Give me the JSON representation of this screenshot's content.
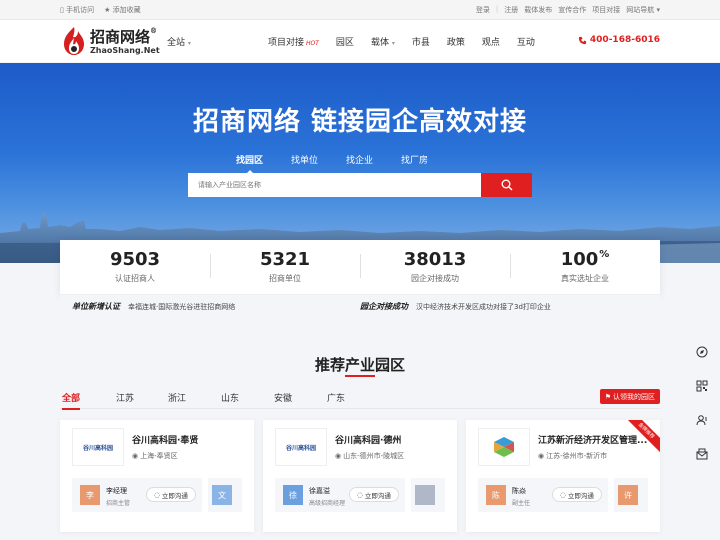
{
  "topbar": {
    "mobile": "手机访问",
    "favorite": "添加收藏",
    "links": [
      "登录",
      "注册",
      "载体发布",
      "宣传合作",
      "项目对接",
      "网站导航"
    ]
  },
  "header": {
    "logo_text": "招商网络",
    "logo_sub": "ZhaoShang.Net",
    "site_select": "全站",
    "nav": [
      {
        "label": "项目对接",
        "badge": "HOT"
      },
      {
        "label": "园区"
      },
      {
        "label": "载体"
      },
      {
        "label": "市县"
      },
      {
        "label": "政策"
      },
      {
        "label": "观点"
      },
      {
        "label": "互动"
      }
    ],
    "phone": "400-168-6016"
  },
  "hero": {
    "slogan": "招商网络 链接园企高效对接",
    "tabs": [
      "找园区",
      "找单位",
      "找企业",
      "找厂房"
    ],
    "search_placeholder": "请输入产业园区名称"
  },
  "stats": [
    {
      "value": "9503",
      "label": "认证招商人"
    },
    {
      "value": "5321",
      "label": "招商单位"
    },
    {
      "value": "38013",
      "label": "园企对接成功"
    },
    {
      "value": "100",
      "suffix": "%",
      "label": "真实选址企业"
    }
  ],
  "ticker": {
    "left_title": "单位新增认证",
    "left_text": "幸福连城·国际激光谷进驻招商网络",
    "right_title": "园企对接成功",
    "right_text": "汉中经济技术开发区成功对接了3d打印企业"
  },
  "section": {
    "title": "推荐产业园区",
    "filters": [
      "全部",
      "江苏",
      "浙江",
      "山东",
      "安徽",
      "广东"
    ],
    "claim": "认领我的园区"
  },
  "cards": [
    {
      "name": "谷川高科园·奉贤",
      "location": "上海-奉贤区",
      "logo": "谷川高科园",
      "contact": "李经理",
      "role": "招商主管",
      "avatar": "李",
      "avatar_color": "#e89a6e",
      "chat": "立即沟通",
      "next_avatar": "文",
      "next_color": "#8ab4e8",
      "ribbon": ""
    },
    {
      "name": "谷川高科园·德州",
      "location": "山东-德州市-陵城区",
      "logo": "谷川高科园",
      "contact": "徐嘉溢",
      "role": "高级招商经理",
      "avatar": "徐",
      "avatar_color": "#6aa0e0",
      "chat": "立即沟通",
      "next_avatar": "",
      "next_color": "#b0b8c8",
      "ribbon": ""
    },
    {
      "name": "江苏新沂经济开发区管理...",
      "location": "江苏-徐州市-新沂市",
      "logo": "",
      "contact": "陈焱",
      "role": "副主任",
      "avatar": "陈",
      "avatar_color": "#e89a6e",
      "chat": "立即沟通",
      "next_avatar": "许",
      "next_color": "#e89a6e",
      "ribbon": "金牌推荐"
    }
  ],
  "side_tools": [
    "compass-icon",
    "qrcode-icon",
    "user-service-icon",
    "mail-icon"
  ],
  "colors": {
    "accent": "#e02020",
    "hero": "#2b73d8"
  }
}
